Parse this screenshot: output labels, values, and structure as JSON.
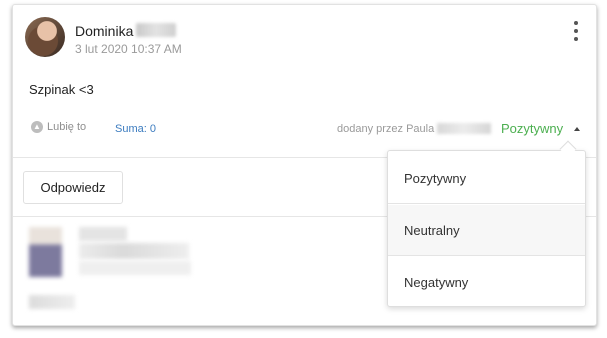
{
  "post": {
    "author_name": "Dominika",
    "timestamp": "3 lut 2020 10:37 AM",
    "text": "Szpinak <3",
    "like_label": "Lubię to",
    "sum_label": "Suma: 0",
    "added_by_label": "dodany przez Paula",
    "status_label": "Pozytywny",
    "reply_label": "Odpowiedz"
  },
  "dropdown": {
    "options": [
      "Pozytywny",
      "Neutralny",
      "Negatywny"
    ]
  },
  "colors": {
    "status_green": "#4caf50",
    "link_blue": "#3b7bbf"
  },
  "icons": {
    "avatar": "user-photo",
    "more": "kebab-menu-icon",
    "like": "thumbs-up-icon",
    "caret": "caret-up-icon"
  }
}
